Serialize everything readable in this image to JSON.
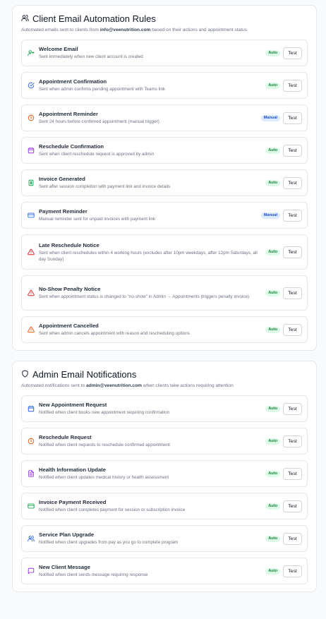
{
  "client_section": {
    "title": "Client Email Automation Rules",
    "subtitle_prefix": "Automated emails sent to clients from ",
    "subtitle_email": "info@veenutrition.com",
    "subtitle_suffix": " based on their actions and appointment status",
    "rules": [
      {
        "title": "Welcome Email",
        "desc": "Sent immediately when new client account is created",
        "badge": "Auto",
        "icon": "user-plus-icon",
        "color": "#16a34a",
        "h": 38
      },
      {
        "title": "Appointment Confirmation",
        "desc": "Sent when admin confirms pending appointment with Teams link",
        "badge": "Auto",
        "icon": "check-circle-icon",
        "color": "#2563eb",
        "h": 38
      },
      {
        "title": "Appointment Reminder",
        "desc": "Sent 24 hours before confirmed appointment (manual trigger)",
        "badge": "Manual",
        "icon": "clock-icon",
        "color": "#ea580c",
        "h": 38
      },
      {
        "title": "Reschedule Confirmation",
        "desc": "Sent when client reschedule request is approved by admin",
        "badge": "Auto",
        "icon": "calendar-icon",
        "color": "#9333ea",
        "h": 38
      },
      {
        "title": "Invoice Generated",
        "desc": "Sent after session completion with payment link and invoice details",
        "badge": "Auto",
        "icon": "invoice-icon",
        "color": "#16a34a",
        "h": 38
      },
      {
        "title": "Payment Reminder",
        "desc": "Manual reminder sent for unpaid invoices with payment link",
        "badge": "Manual",
        "icon": "credit-card-icon",
        "color": "#2563eb",
        "h": 38
      },
      {
        "title": "Late Reschedule Notice",
        "desc": "Sent when client reschedules within 4 working hours (excludes after 10pm weekdays, after 12pm Saturdays, all day Sunday)",
        "badge": "Auto",
        "icon": "warning-icon",
        "color": "#dc2626",
        "h": 50
      },
      {
        "title": "No-Show Penalty Notice",
        "desc": "Sent when appointment status is changed to \"no-show\" in Admin → Appointments (triggers penalty invoice)",
        "badge": "Auto",
        "icon": "warning-icon",
        "color": "#dc2626",
        "h": 50
      },
      {
        "title": "Appointment Cancelled",
        "desc": "Sent when admin cancels appointment with reason and rescheduling options",
        "badge": "Auto",
        "icon": "warning-icon",
        "color": "#ea580c",
        "h": 38
      }
    ]
  },
  "admin_section": {
    "title": "Admin Email Notifications",
    "subtitle_prefix": "Automated notifications sent to ",
    "subtitle_email": "admin@veenutrition.com",
    "subtitle_suffix": " when clients take actions requiring attention",
    "rules": [
      {
        "title": "New Appointment Request",
        "desc": "Notified when client books new appointment requiring confirmation",
        "badge": "Auto",
        "icon": "calendar-icon",
        "color": "#2563eb",
        "h": 38
      },
      {
        "title": "Reschedule Request",
        "desc": "Notified when client requests to reschedule confirmed appointment",
        "badge": "Auto",
        "icon": "clock-icon",
        "color": "#ea580c",
        "h": 38
      },
      {
        "title": "Health Information Update",
        "desc": "Notified when client updates medical history or health assessment",
        "badge": "Auto",
        "icon": "document-icon",
        "color": "#9333ea",
        "h": 38
      },
      {
        "title": "Invoice Payment Received",
        "desc": "Notified when client completes payment for session or subscription invoice",
        "badge": "Auto",
        "icon": "credit-card-icon",
        "color": "#16a34a",
        "h": 38
      },
      {
        "title": "Service Plan Upgrade",
        "desc": "Notified when client upgrades from pay as you go to complete program",
        "badge": "Auto",
        "icon": "users-icon",
        "color": "#2563eb",
        "h": 38
      },
      {
        "title": "New Client Message",
        "desc": "Notified when client sends message requiring response",
        "badge": "Auto",
        "icon": "message-icon",
        "color": "#9333ea",
        "h": 38
      }
    ]
  },
  "test_label": "Test"
}
